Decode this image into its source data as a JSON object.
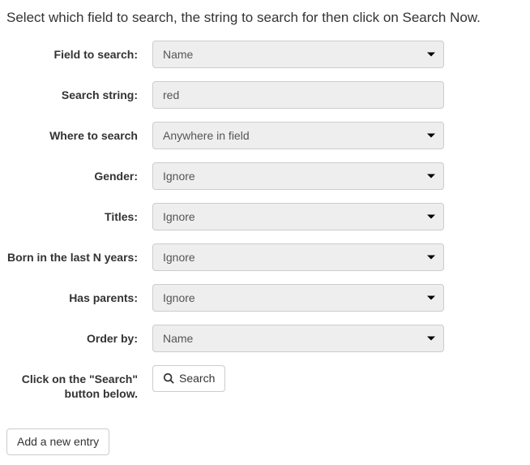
{
  "intro": "Select which field to search, the string to search for then click on Search Now.",
  "fields": {
    "field_to_search": {
      "label": "Field to search:",
      "value": "Name"
    },
    "search_string": {
      "label": "Search string:",
      "value": "red"
    },
    "where_to_search": {
      "label": "Where to search",
      "value": "Anywhere in field"
    },
    "gender": {
      "label": "Gender:",
      "value": "Ignore"
    },
    "titles": {
      "label": "Titles:",
      "value": "Ignore"
    },
    "born_last_n": {
      "label": "Born in the last N years:",
      "value": "Ignore"
    },
    "has_parents": {
      "label": "Has parents:",
      "value": "Ignore"
    },
    "order_by": {
      "label": "Order by:",
      "value": "Name"
    },
    "search_row": {
      "label": "Click on the \"Search\" button below.",
      "button": "Search"
    }
  },
  "add_entry_button": "Add a new entry"
}
